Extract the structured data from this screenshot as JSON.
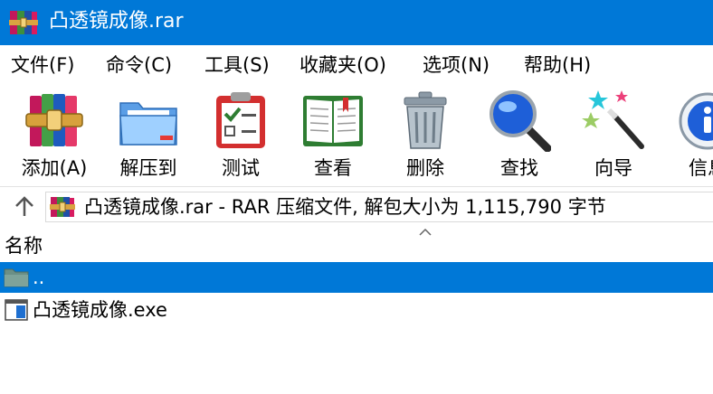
{
  "window": {
    "title": "凸透镜成像.rar",
    "icon": "winrar-books-icon"
  },
  "menu": [
    {
      "label": "文件(F)"
    },
    {
      "label": "命令(C)"
    },
    {
      "label": "工具(S)"
    },
    {
      "label": "收藏夹(O)"
    },
    {
      "label": "选项(N)"
    },
    {
      "label": "帮助(H)"
    }
  ],
  "toolbar": [
    {
      "label": "添加(A)",
      "icon": "add-archive-icon"
    },
    {
      "label": "解压到",
      "icon": "extract-folder-icon"
    },
    {
      "label": "测试",
      "icon": "test-clipboard-icon"
    },
    {
      "label": "查看",
      "icon": "view-book-icon"
    },
    {
      "label": "删除",
      "icon": "trash-icon"
    },
    {
      "label": "查找",
      "icon": "magnifier-icon"
    },
    {
      "label": "向导",
      "icon": "wizard-wand-icon"
    },
    {
      "label": "信息",
      "icon": "info-icon"
    }
  ],
  "address": {
    "text": "凸透镜成像.rar - RAR 压缩文件, 解包大小为 1,115,790 字节"
  },
  "columns": {
    "name": "名称"
  },
  "files": [
    {
      "name": "..",
      "icon": "folder-icon",
      "selected": true
    },
    {
      "name": "凸透镜成像.exe",
      "icon": "exe-file-icon",
      "selected": false
    }
  ],
  "colors": {
    "titlebar": "#0078d7",
    "selection": "#0078d7"
  }
}
